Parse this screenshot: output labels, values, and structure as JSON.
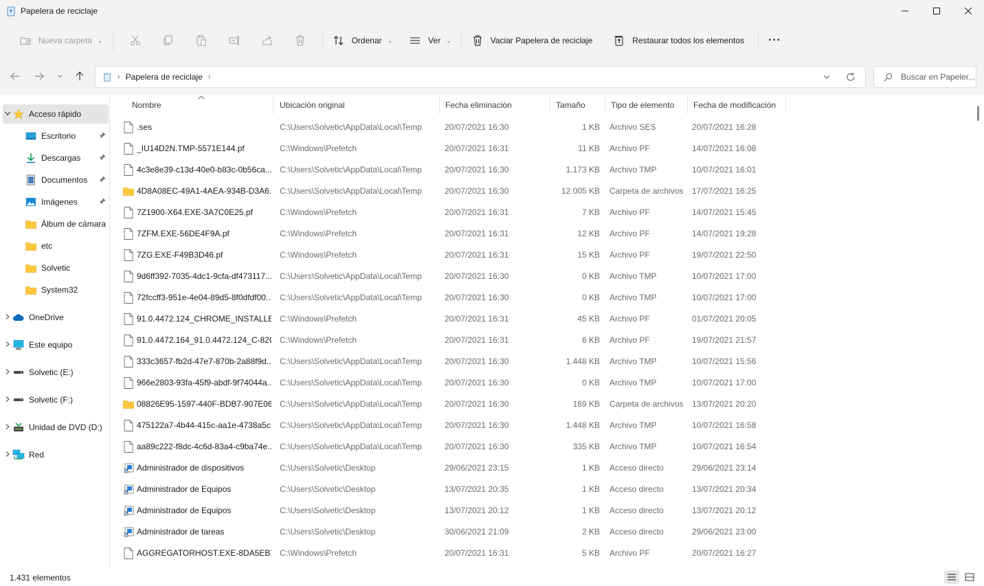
{
  "window": {
    "title": "Papelera de reciclaje",
    "minimize": "—",
    "maximize": "☐",
    "close": "✕"
  },
  "toolbar": {
    "new_folder": "Nueva carpeta",
    "sort": "Ordenar",
    "view": "Ver",
    "empty_bin": "Vaciar Papelera de reciclaje",
    "restore_all": "Restaurar todos los elementos",
    "more": "···"
  },
  "address": {
    "breadcrumb": "Papelera de reciclaje",
    "search_placeholder": "Buscar en Papeler..."
  },
  "sidebar": {
    "items": [
      {
        "label": "Acceso rápido",
        "icon": "star-icon"
      },
      {
        "label": "Escritorio",
        "icon": "desktop-icon"
      },
      {
        "label": "Descargas",
        "icon": "download-icon"
      },
      {
        "label": "Documentos",
        "icon": "document-icon"
      },
      {
        "label": "Imágenes",
        "icon": "pictures-icon"
      },
      {
        "label": "Álbum de cámara",
        "icon": "folder-icon"
      },
      {
        "label": "etc",
        "icon": "folder-icon"
      },
      {
        "label": "Solvetic",
        "icon": "folder-icon"
      },
      {
        "label": "System32",
        "icon": "folder-icon"
      },
      {
        "label": "OneDrive",
        "icon": "cloud-icon"
      },
      {
        "label": "Este equipo",
        "icon": "computer-icon"
      },
      {
        "label": "Solvetic (E:)",
        "icon": "drive-icon"
      },
      {
        "label": "Solvetic (F:)",
        "icon": "drive-icon"
      },
      {
        "label": "Unidad de DVD (D:)",
        "icon": "dvd-icon"
      },
      {
        "label": "Red",
        "icon": "network-icon"
      }
    ]
  },
  "columns": {
    "name": "Nombre",
    "original": "Ubicación original",
    "deleted": "Fecha eliminación",
    "size": "Tamaño",
    "type": "Tipo de elemento",
    "modified": "Fecha de modificación"
  },
  "files": [
    {
      "name": ".ses",
      "orig": "C:\\Users\\Solvetic\\AppData\\Local\\Temp",
      "del": "20/07/2021 16:30",
      "size": "1 KB",
      "type": "Archivo SES",
      "mod": "20/07/2021 16:28",
      "icon": "file-icon"
    },
    {
      "name": "_IU14D2N.TMP-5571E144.pf",
      "orig": "C:\\Windows\\Prefetch",
      "del": "20/07/2021 16:31",
      "size": "11 KB",
      "type": "Archivo PF",
      "mod": "14/07/2021 16:08",
      "icon": "file-icon"
    },
    {
      "name": "4c3e8e39-c13d-40e0-b83c-0b56ca...",
      "orig": "C:\\Users\\Solvetic\\AppData\\Local\\Temp",
      "del": "20/07/2021 16:30",
      "size": "1.173 KB",
      "type": "Archivo TMP",
      "mod": "10/07/2021 16:01",
      "icon": "file-icon"
    },
    {
      "name": "4D8A08EC-49A1-4AEA-934B-D3A6...",
      "orig": "C:\\Users\\Solvetic\\AppData\\Local\\Temp",
      "del": "20/07/2021 16:30",
      "size": "12.005 KB",
      "type": "Carpeta de archivos",
      "mod": "17/07/2021 16:25",
      "icon": "folder-icon"
    },
    {
      "name": "7Z1900-X64.EXE-3A7C0E25.pf",
      "orig": "C:\\Windows\\Prefetch",
      "del": "20/07/2021 16:31",
      "size": "7 KB",
      "type": "Archivo PF",
      "mod": "14/07/2021 15:45",
      "icon": "file-icon"
    },
    {
      "name": "7ZFM.EXE-56DE4F9A.pf",
      "orig": "C:\\Windows\\Prefetch",
      "del": "20/07/2021 16:31",
      "size": "12 KB",
      "type": "Archivo PF",
      "mod": "14/07/2021 19:28",
      "icon": "file-icon"
    },
    {
      "name": "7ZG.EXE-F49B3D46.pf",
      "orig": "C:\\Windows\\Prefetch",
      "del": "20/07/2021 16:31",
      "size": "15 KB",
      "type": "Archivo PF",
      "mod": "19/07/2021 22:50",
      "icon": "file-icon"
    },
    {
      "name": "9d6ff392-7035-4dc1-9cfa-df473117...",
      "orig": "C:\\Users\\Solvetic\\AppData\\Local\\Temp",
      "del": "20/07/2021 16:30",
      "size": "0 KB",
      "type": "Archivo TMP",
      "mod": "10/07/2021 17:00",
      "icon": "file-icon"
    },
    {
      "name": "72fccff3-951e-4e04-89d5-8f0dfdf00...",
      "orig": "C:\\Users\\Solvetic\\AppData\\Local\\Temp",
      "del": "20/07/2021 16:30",
      "size": "0 KB",
      "type": "Archivo TMP",
      "mod": "10/07/2021 17:00",
      "icon": "file-icon"
    },
    {
      "name": "91.0.4472.124_CHROME_INSTALLE-...",
      "orig": "C:\\Windows\\Prefetch",
      "del": "20/07/2021 16:31",
      "size": "45 KB",
      "type": "Archivo PF",
      "mod": "01/07/2021 20:05",
      "icon": "file-icon"
    },
    {
      "name": "91.0.4472.164_91.0.4472.124_C-82C...",
      "orig": "C:\\Windows\\Prefetch",
      "del": "20/07/2021 16:31",
      "size": "6 KB",
      "type": "Archivo PF",
      "mod": "19/07/2021 21:57",
      "icon": "file-icon"
    },
    {
      "name": "333c3657-fb2d-47e7-870b-2a88f9d...",
      "orig": "C:\\Users\\Solvetic\\AppData\\Local\\Temp",
      "del": "20/07/2021 16:30",
      "size": "1.448 KB",
      "type": "Archivo TMP",
      "mod": "10/07/2021 15:56",
      "icon": "file-icon"
    },
    {
      "name": "966e2803-93fa-45f9-abdf-9f74044a...",
      "orig": "C:\\Users\\Solvetic\\AppData\\Local\\Temp",
      "del": "20/07/2021 16:30",
      "size": "0 KB",
      "type": "Archivo TMP",
      "mod": "10/07/2021 17:00",
      "icon": "file-icon"
    },
    {
      "name": "08826E95-1597-440F-BDB7-907E06...",
      "orig": "C:\\Users\\Solvetic\\AppData\\Local\\Temp",
      "del": "20/07/2021 16:30",
      "size": "169 KB",
      "type": "Carpeta de archivos",
      "mod": "13/07/2021 20:20",
      "icon": "folder-icon"
    },
    {
      "name": "475122a7-4b44-415c-aa1e-4738a5c...",
      "orig": "C:\\Users\\Solvetic\\AppData\\Local\\Temp",
      "del": "20/07/2021 16:30",
      "size": "1.448 KB",
      "type": "Archivo TMP",
      "mod": "10/07/2021 16:58",
      "icon": "file-icon"
    },
    {
      "name": "aa89c222-f8dc-4c6d-83a4-c9ba74e...",
      "orig": "C:\\Users\\Solvetic\\AppData\\Local\\Temp",
      "del": "20/07/2021 16:30",
      "size": "335 KB",
      "type": "Archivo TMP",
      "mod": "10/07/2021 16:54",
      "icon": "file-icon"
    },
    {
      "name": "Administrador de dispositivos",
      "orig": "C:\\Users\\Solvetic\\Desktop",
      "del": "29/06/2021 23:15",
      "size": "1 KB",
      "type": "Acceso directo",
      "mod": "29/06/2021 23:14",
      "icon": "shortcut-icon"
    },
    {
      "name": "Administrador de Equipos",
      "orig": "C:\\Users\\Solvetic\\Desktop",
      "del": "13/07/2021 20:35",
      "size": "1 KB",
      "type": "Acceso directo",
      "mod": "13/07/2021 20:34",
      "icon": "shortcut-icon"
    },
    {
      "name": "Administrador de Equipos",
      "orig": "C:\\Users\\Solvetic\\Desktop",
      "del": "13/07/2021 20:12",
      "size": "1 KB",
      "type": "Acceso directo",
      "mod": "13/07/2021 20:12",
      "icon": "shortcut-icon"
    },
    {
      "name": "Administrador de tareas",
      "orig": "C:\\Users\\Solvetic\\Desktop",
      "del": "30/06/2021 21:09",
      "size": "2 KB",
      "type": "Acceso directo",
      "mod": "29/06/2021 23:00",
      "icon": "shortcut-icon"
    },
    {
      "name": "AGGREGATORHOST.EXE-8DA5EB72...",
      "orig": "C:\\Windows\\Prefetch",
      "del": "20/07/2021 16:31",
      "size": "5 KB",
      "type": "Archivo PF",
      "mod": "20/07/2021 16:27",
      "icon": "file-icon"
    }
  ],
  "status": {
    "count": "1.431 elementos"
  },
  "colors": {
    "chrome_bg": "#f3f3f3",
    "selected_bg": "#e5e5e5",
    "folder_yellow": "#ffc83d",
    "accent_blue": "#0078d4"
  }
}
